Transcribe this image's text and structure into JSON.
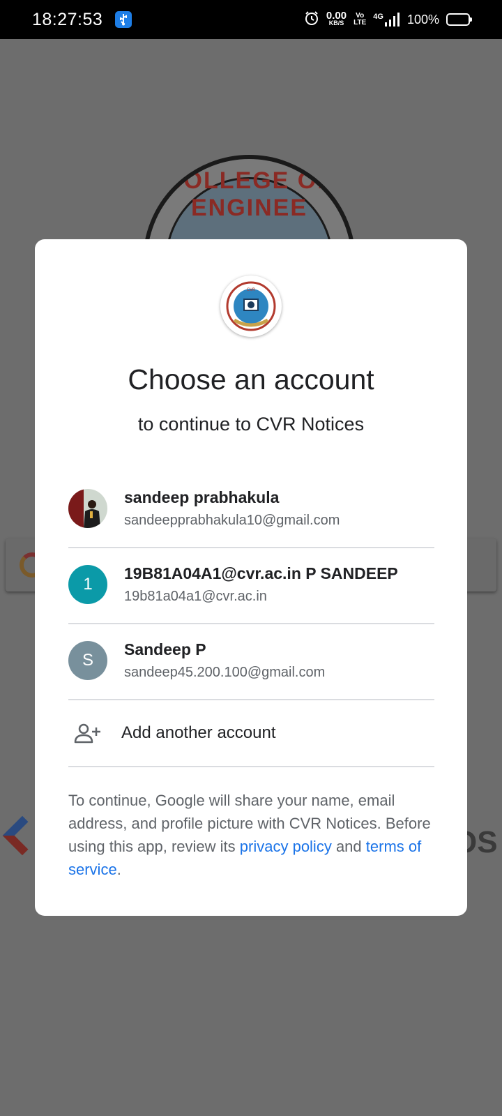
{
  "status_bar": {
    "time": "18:27:53",
    "net_speed_value": "0.00",
    "net_speed_unit": "KB/S",
    "volte_top": "Vo",
    "volte_bottom": "LTE",
    "network": "4G",
    "battery_percent": "100%"
  },
  "background": {
    "logo_text": "COLLEGE OF ENGINEE",
    "os_text": "OS"
  },
  "dialog": {
    "title": "Choose an account",
    "subtitle": "to continue to CVR Notices",
    "accounts": [
      {
        "name": "sandeep prabhakula",
        "email": "sandeepprabhakula10@gmail.com",
        "avatar_type": "photo"
      },
      {
        "name": "19B81A04A1@cvr.ac.in P SANDEEP",
        "email": "19b81a04a1@cvr.ac.in",
        "avatar_letter": "1",
        "avatar_color": "#0b9aa8"
      },
      {
        "name": "Sandeep P",
        "email": "sandeep45.200.100@gmail.com",
        "avatar_letter": "S",
        "avatar_color": "#78909c"
      }
    ],
    "add_account_label": "Add another account",
    "footer": {
      "text_before": "To continue, Google will share your name, email address, and profile picture with CVR Notices. Before using this app, review its ",
      "privacy_link": "privacy policy",
      "and_text": " and ",
      "terms_link": "terms of service",
      "period": "."
    }
  },
  "colors": {
    "link": "#1a73e8",
    "scrim": "#6d6d6d"
  }
}
